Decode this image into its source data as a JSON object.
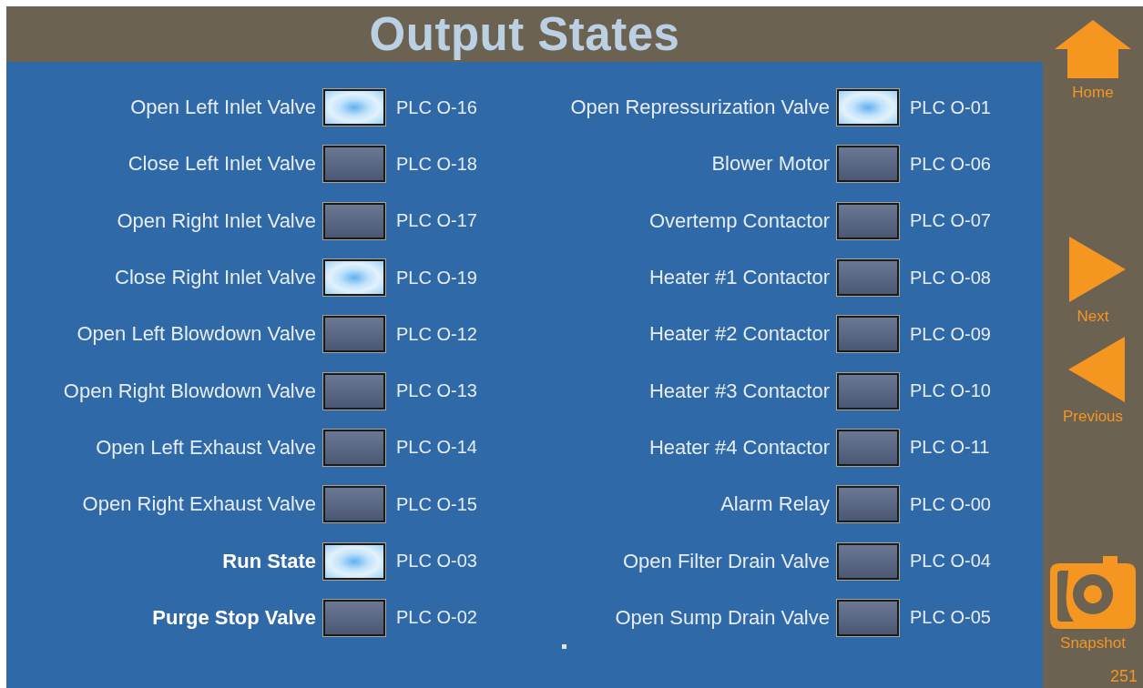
{
  "title": "Output States",
  "columns": [
    {
      "outputs": [
        {
          "label": "Open Left Inlet Valve",
          "on": true,
          "bold": false,
          "address": "PLC O-16"
        },
        {
          "label": "Close Left Inlet Valve",
          "on": false,
          "bold": false,
          "address": "PLC O-18"
        },
        {
          "label": "Open Right Inlet Valve",
          "on": false,
          "bold": false,
          "address": "PLC O-17"
        },
        {
          "label": "Close Right Inlet Valve",
          "on": true,
          "bold": false,
          "address": "PLC O-19"
        },
        {
          "label": "Open Left Blowdown Valve",
          "on": false,
          "bold": false,
          "address": "PLC O-12"
        },
        {
          "label": "Open Right Blowdown Valve",
          "on": false,
          "bold": false,
          "address": "PLC O-13"
        },
        {
          "label": "Open Left Exhaust Valve",
          "on": false,
          "bold": false,
          "address": "PLC O-14"
        },
        {
          "label": "Open Right Exhaust Valve",
          "on": false,
          "bold": false,
          "address": "PLC O-15"
        },
        {
          "label": "Run State",
          "on": true,
          "bold": true,
          "address": "PLC O-03"
        },
        {
          "label": "Purge Stop Valve",
          "on": false,
          "bold": true,
          "address": "PLC O-02"
        }
      ]
    },
    {
      "outputs": [
        {
          "label": "Open Repressurization Valve",
          "on": true,
          "bold": false,
          "address": "PLC O-01"
        },
        {
          "label": "Blower Motor",
          "on": false,
          "bold": false,
          "address": "PLC O-06"
        },
        {
          "label": "Overtemp Contactor",
          "on": false,
          "bold": false,
          "address": "PLC O-07"
        },
        {
          "label": "Heater #1 Contactor",
          "on": false,
          "bold": false,
          "address": "PLC O-08"
        },
        {
          "label": "Heater #2 Contactor",
          "on": false,
          "bold": false,
          "address": "PLC O-09"
        },
        {
          "label": "Heater #3 Contactor",
          "on": false,
          "bold": false,
          "address": "PLC O-10"
        },
        {
          "label": "Heater #4 Contactor",
          "on": false,
          "bold": false,
          "address": "PLC O-11"
        },
        {
          "label": "Alarm Relay",
          "on": false,
          "bold": false,
          "address": "PLC O-00"
        },
        {
          "label": "Open Filter Drain Valve",
          "on": false,
          "bold": false,
          "address": "PLC O-04"
        },
        {
          "label": "Open Sump Drain Valve",
          "on": false,
          "bold": false,
          "address": "PLC O-05"
        }
      ]
    }
  ],
  "sidebar": {
    "buttons": [
      {
        "kind": "home",
        "label": "Home"
      },
      {
        "kind": "next",
        "label": "Next"
      },
      {
        "kind": "previous",
        "label": "Previous"
      },
      {
        "kind": "snapshot",
        "label": "Snapshot"
      }
    ],
    "screen_number": "251"
  }
}
